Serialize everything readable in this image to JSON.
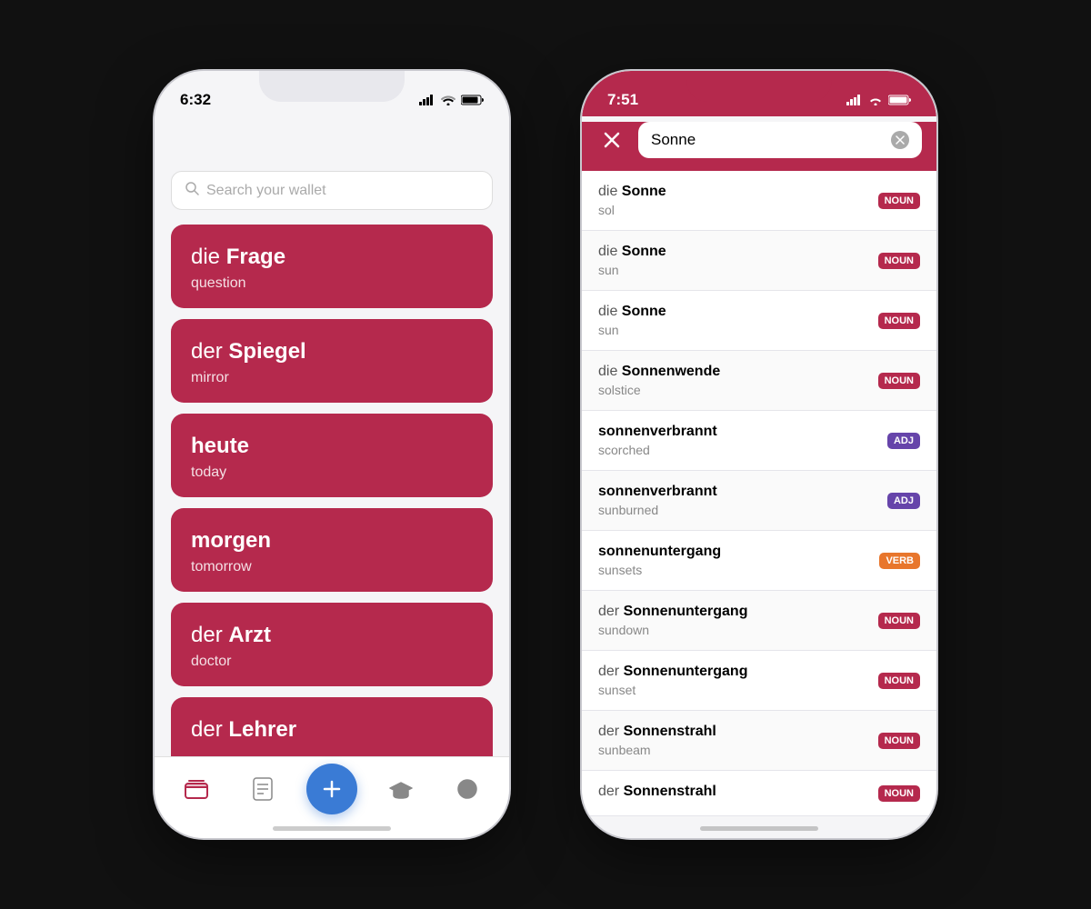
{
  "phone1": {
    "time": "6:32",
    "search_placeholder": "Search your wallet",
    "cards": [
      {
        "article": "die",
        "german": "Frage",
        "translation": "question"
      },
      {
        "article": "der",
        "german": "Spiegel",
        "translation": "mirror"
      },
      {
        "article": "",
        "german": "heute",
        "translation": "today"
      },
      {
        "article": "",
        "german": "morgen",
        "translation": "tomorrow"
      },
      {
        "article": "der",
        "german": "Arzt",
        "translation": "doctor"
      },
      {
        "article": "der",
        "german": "Lehrer",
        "translation": ""
      }
    ],
    "nav": {
      "add_label": "+"
    }
  },
  "phone2": {
    "time": "7:51",
    "search_value": "Sonne",
    "results": [
      {
        "article": "die",
        "word": "Sonne",
        "translation": "sol",
        "tag": "NOUN",
        "tag_type": "noun"
      },
      {
        "article": "die",
        "word": "Sonne",
        "translation": "sun",
        "tag": "NOUN",
        "tag_type": "noun"
      },
      {
        "article": "die",
        "word": "Sonne",
        "translation": "sun",
        "tag": "NOUN",
        "tag_type": "noun"
      },
      {
        "article": "die",
        "word": "Sonnenwende",
        "translation": "solstice",
        "tag": "NOUN",
        "tag_type": "noun"
      },
      {
        "article": "",
        "word": "sonnenverbrannt",
        "translation": "scorched",
        "tag": "ADJ",
        "tag_type": "adj"
      },
      {
        "article": "",
        "word": "sonnenverbrannt",
        "translation": "sunburned",
        "tag": "ADJ",
        "tag_type": "adj"
      },
      {
        "article": "",
        "word": "sonnenuntergang",
        "translation": "sunsets",
        "tag": "VERB",
        "tag_type": "verb"
      },
      {
        "article": "der",
        "word": "Sonnenuntergang",
        "translation": "sundown",
        "tag": "NOUN",
        "tag_type": "noun"
      },
      {
        "article": "der",
        "word": "Sonnenuntergang",
        "translation": "sunset",
        "tag": "NOUN",
        "tag_type": "noun"
      },
      {
        "article": "der",
        "word": "Sonnenstrahl",
        "translation": "sunbeam",
        "tag": "NOUN",
        "tag_type": "noun"
      },
      {
        "article": "der",
        "word": "Sonnenstrahl",
        "translation": "",
        "tag": "NOUN",
        "tag_type": "noun"
      }
    ]
  },
  "brand_color": "#b5294d",
  "accent_blue": "#3a7bd5"
}
